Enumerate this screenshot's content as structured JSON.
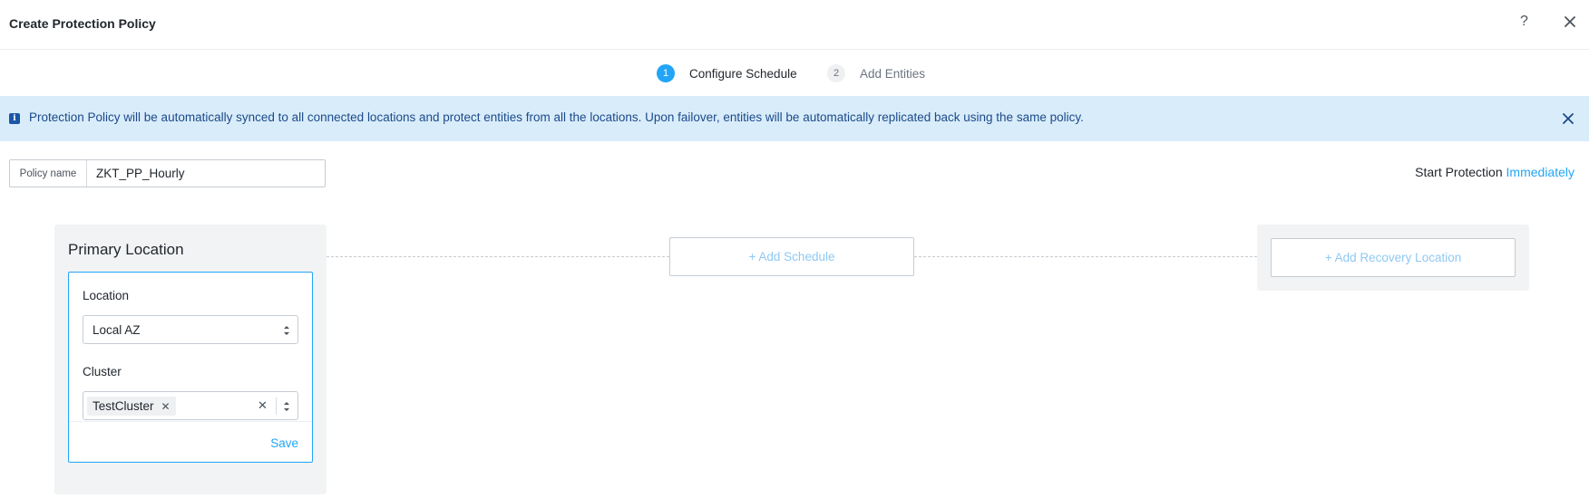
{
  "header": {
    "title": "Create Protection Policy",
    "help_icon": "?",
    "close_icon": "close-icon"
  },
  "steps": [
    {
      "number": "1",
      "label": "Configure Schedule",
      "active": true
    },
    {
      "number": "2",
      "label": "Add Entities",
      "active": false
    }
  ],
  "banner": {
    "text": "Protection Policy will be automatically synced to all connected locations and protect entities from all the locations. Upon failover, entities will be automatically replicated back using the same policy.",
    "icon": "info-icon"
  },
  "policy": {
    "label": "Policy name",
    "value": "ZKT_PP_Hourly"
  },
  "start_protection": {
    "label": "Start Protection",
    "value": "Immediately"
  },
  "primary_location": {
    "title": "Primary Location",
    "location_label": "Location",
    "location_value": "Local AZ",
    "cluster_label": "Cluster",
    "cluster_tag": "TestCluster",
    "save_label": "Save"
  },
  "add_schedule_label": "+ Add Schedule",
  "add_recovery_label": "+ Add Recovery Location",
  "colors": {
    "accent": "#22a5f7",
    "banner_bg": "#d9ecfa",
    "panel_bg": "#f2f3f4"
  }
}
